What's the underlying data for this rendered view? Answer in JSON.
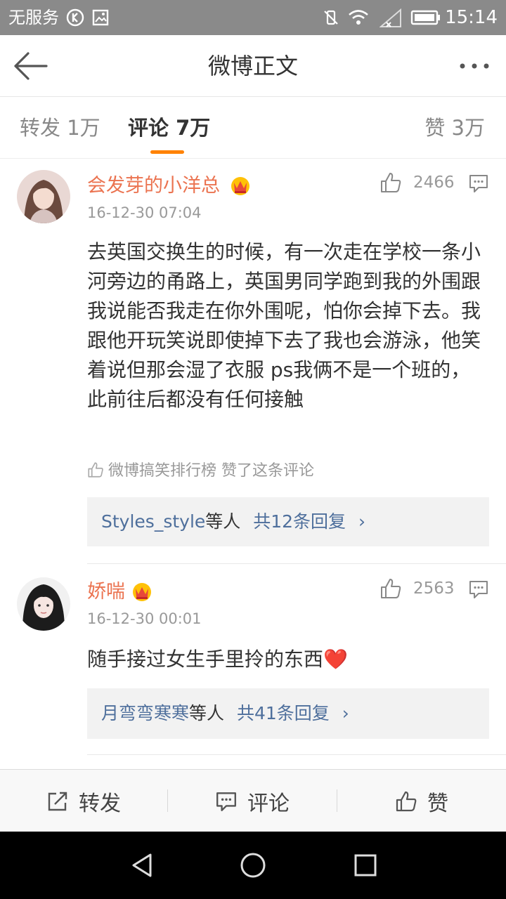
{
  "status_bar": {
    "carrier": "无服务",
    "time": "15:14",
    "icons": [
      "k-icon",
      "image-icon",
      "vibrate-off-icon",
      "wifi-icon",
      "signal-icon",
      "battery-icon"
    ]
  },
  "nav": {
    "title": "微博正文",
    "icons": [
      "back-arrow-icon",
      "more-icon"
    ]
  },
  "tabs": [
    {
      "label": "转发 1万",
      "active": false
    },
    {
      "label": "评论 7万",
      "active": true
    },
    {
      "label": "赞 3万",
      "active": false
    }
  ],
  "colors": {
    "accent": "#ff8200",
    "username": "#eb7350",
    "link_blue": "#4e6f9c",
    "reply_bg": "#f2f2f2"
  },
  "comments": [
    {
      "username": "会发芽的小洋总",
      "date": "16-12-30 07:04",
      "likes": "2466",
      "text": "去英国交换生的时候，有一次走在学校一条小河旁边的甬路上，英国男同学跑到我的外围跟我说能否我走在你外围呢，怕你会掉下去。我跟他开玩笑说即使掉下去了我也会游泳，他笑着说但那会湿了衣服 ps我俩不是一个班的，此前往后都没有任何接触",
      "liked_by": "微博搞笑排行榜 赞了这条评论",
      "reply_users": "Styles_style",
      "reply_suffix": "等人",
      "reply_count": "共12条回复",
      "reply_arrow": "›"
    },
    {
      "username": "娇喘",
      "date": "16-12-30 00:01",
      "likes": "2563",
      "text": "随手接过女生手里拎的东西❤️",
      "reply_users": "月弯弯寒寒",
      "reply_suffix": "等人",
      "reply_count": "共41条回复",
      "reply_arrow": "›"
    }
  ],
  "actions": {
    "repost": "转发",
    "comment": "评论",
    "like": "赞"
  },
  "system_nav": [
    "back-triangle-icon",
    "home-circle-icon",
    "recents-square-icon"
  ]
}
